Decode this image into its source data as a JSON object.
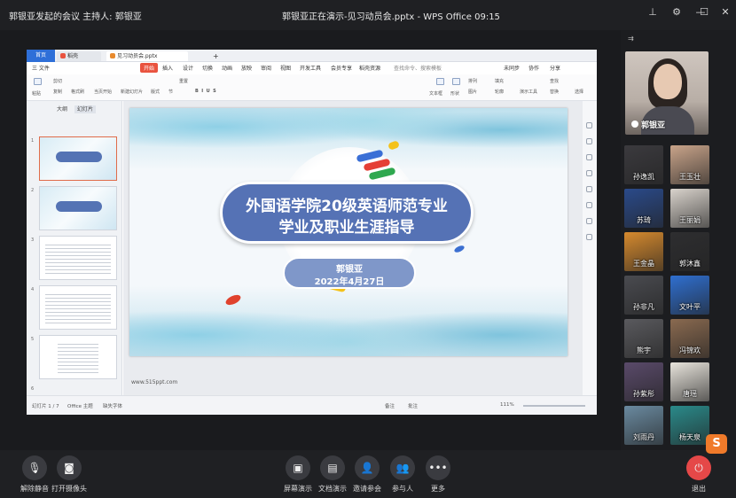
{
  "topbar": {
    "meeting_title": "郭银亚发起的会议    主持人: 郭银亚",
    "window_title": "郭银亚正在演示-见习动员会.pptx - WPS Office 09:15",
    "controls": [
      "pin-icon",
      "settings-icon",
      "minimize-icon",
      "maximize-icon",
      "close-icon"
    ]
  },
  "wps": {
    "tabs": {
      "home": "首页",
      "draft": "稻壳",
      "doc": "见习动员会.pptx"
    },
    "menu": [
      "三 文件",
      "开始",
      "插入",
      "设计",
      "切换",
      "动画",
      "放映",
      "审阅",
      "视图",
      "开发工具",
      "会员专享",
      "稻壳资源"
    ],
    "search_placeholder": "查找命令、搜索模板",
    "ribbon_right": [
      "未同步",
      "协作",
      "分享"
    ],
    "ribbon": {
      "paste": "粘贴",
      "cut": "剪切",
      "copy": "复制",
      "format_painter": "格式刷",
      "from_current": "当页开始",
      "new_slide": "新建幻灯片",
      "layout": "版式",
      "section": "节",
      "reset": "重置",
      "textbox": "文本框",
      "shape": "形状",
      "arrange": "排列",
      "picture": "图片",
      "fill": "填充",
      "find": "查找",
      "outline": "轮廓",
      "present_tools": "演示工具",
      "replace": "替换",
      "select": "选择"
    },
    "left_panel": {
      "tab_outline": "大纲",
      "tab_slides": "幻灯片"
    },
    "slide_numbers": [
      "1",
      "2",
      "3",
      "4",
      "5",
      "6"
    ],
    "slide": {
      "title_line1": "外国语学院20级英语师范专业",
      "title_line2": "学业及职业生涯指导",
      "presenter": "郭银亚",
      "date": "2022年4月27日"
    },
    "footer_url": "www.515ppt.com",
    "status": {
      "slide_count": "幻灯片 1 / 7",
      "theme": "Office 主题",
      "font_missing": "缺失字体",
      "notes": "备注",
      "comments": "批注",
      "zoom": "111%"
    }
  },
  "participants": {
    "speaker": {
      "name": "郭银亚"
    },
    "others": [
      {
        "name": "孙逸凯",
        "color": "#3b3a3e"
      },
      {
        "name": "王玉壮",
        "color": "#c9a48a"
      },
      {
        "name": "苏琦",
        "color": "#2a4a8a"
      },
      {
        "name": "王丽娟",
        "color": "#d9d3cc"
      },
      {
        "name": "王金晶",
        "color": "#d68a2e"
      },
      {
        "name": "郭沐鑫",
        "color": "#2e2e30"
      },
      {
        "name": "孙非凡",
        "color": "#4a4b50"
      },
      {
        "name": "文叶平",
        "color": "#2f6fd0"
      },
      {
        "name": "熊宇",
        "color": "#5a5a5e"
      },
      {
        "name": "冯锦欢",
        "color": "#8a6a50"
      },
      {
        "name": "孙紫彤",
        "color": "#5a4a6a"
      },
      {
        "name": "唐瑶",
        "color": "#e8e4dc"
      },
      {
        "name": "刘雨丹",
        "color": "#6a8aa0"
      },
      {
        "name": "杨天泉",
        "color": "#2a8a8a"
      }
    ]
  },
  "bottombar": {
    "unmute": "解除静音",
    "camera": "打开摄像头",
    "share_screen": "屏幕演示",
    "doc_present": "文档演示",
    "invite": "邀请参会",
    "participants": "参与人",
    "more": "更多",
    "leave": "退出"
  },
  "colors": {
    "accent": "#2e6fd8",
    "title_pill": "#5572b5",
    "leave": "#e54848"
  }
}
